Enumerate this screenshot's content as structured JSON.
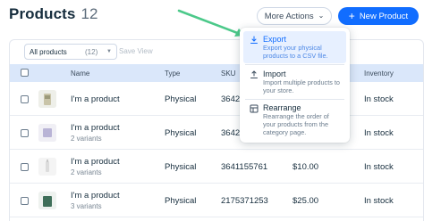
{
  "header": {
    "title": "Products",
    "count": "12",
    "more_actions_label": "More Actions",
    "new_product_label": "New Product"
  },
  "filters": {
    "select_value": "All products",
    "select_count": "(12)",
    "save_view_label": "Save View"
  },
  "table": {
    "columns": [
      "Name",
      "Type",
      "SKU",
      "Inventory"
    ],
    "rows": [
      {
        "name": "I'm a product",
        "variants": "",
        "type": "Physical",
        "sku": "3642",
        "price": "",
        "inventory": "In stock"
      },
      {
        "name": "I'm a product",
        "variants": "2 variants",
        "type": "Physical",
        "sku": "3642",
        "price": "",
        "inventory": "In stock"
      },
      {
        "name": "I'm a product",
        "variants": "2 variants",
        "type": "Physical",
        "sku": "3641155761",
        "price": "$10.00",
        "inventory": "In stock"
      },
      {
        "name": "I'm a product",
        "variants": "3 variants",
        "type": "Physical",
        "sku": "2175371253",
        "price": "$25.00",
        "inventory": "In stock"
      }
    ]
  },
  "menu": {
    "items": [
      {
        "title": "Export",
        "description": "Export your physical products to a CSV file.",
        "icon": "download-icon"
      },
      {
        "title": "Import",
        "description": "Import multiple products to your store.",
        "icon": "upload-icon"
      },
      {
        "title": "Rearrange",
        "description": "Rearrange the order of your products from the category page.",
        "icon": "rearrange-icon"
      }
    ]
  },
  "colors": {
    "accent": "#116dff",
    "header_row": "#dae7fa",
    "arrow": "#4cc98a",
    "menu_highlight": "#e7f0ff"
  }
}
